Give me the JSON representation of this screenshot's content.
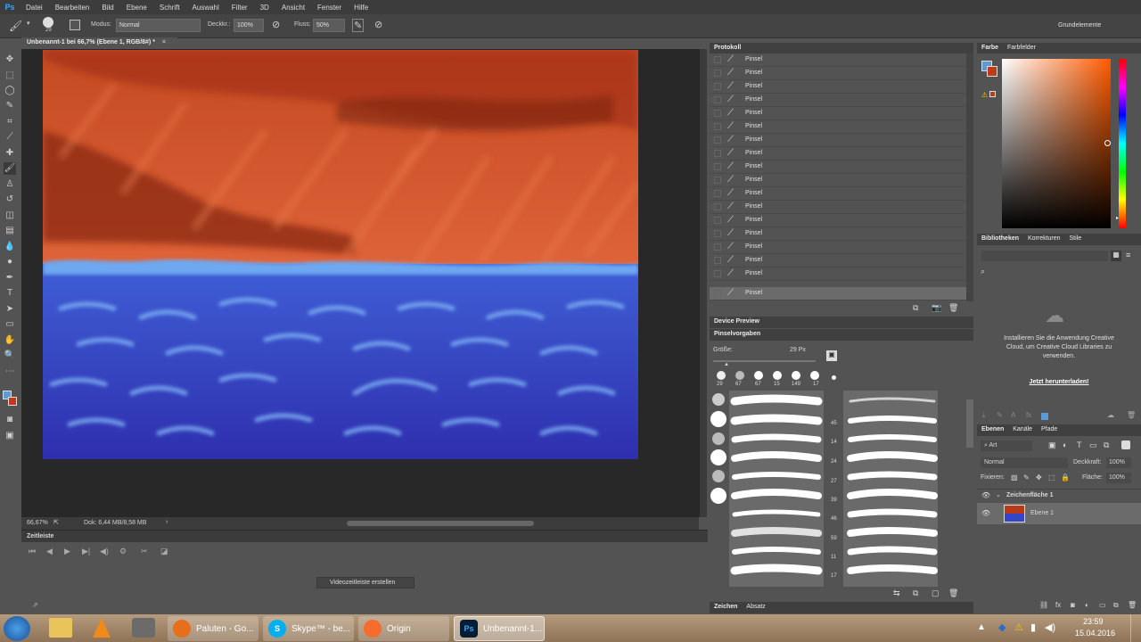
{
  "menubar": {
    "logo": "Ps",
    "items": [
      "Datei",
      "Bearbeiten",
      "Bild",
      "Ebene",
      "Schrift",
      "Auswahl",
      "Filter",
      "3D",
      "Ansicht",
      "Fenster",
      "Hilfe"
    ]
  },
  "options": {
    "brush_size": "29",
    "modus_label": "Modus:",
    "modus_value": "Normal",
    "deckkr_label": "Deckkr.:",
    "deckkr_value": "100%",
    "fluss_label": "Fluss:",
    "fluss_value": "50%",
    "workspace": "Grundelemente"
  },
  "document": {
    "tab_title": "Unbenannt-1 bei 66,7% (Ebene 1, RGB/8#) *",
    "zoom": "66,67%",
    "doc_info": "Dok: 6,44 MB/8,58 MB"
  },
  "timeline": {
    "title": "Zeitleiste",
    "create_button": "Videozeitleiste erstellen"
  },
  "history": {
    "title": "Protokoll",
    "items": [
      "Pinsel",
      "Pinsel",
      "Pinsel",
      "Pinsel",
      "Pinsel",
      "Pinsel",
      "Pinsel",
      "Pinsel",
      "Pinsel",
      "Pinsel",
      "Pinsel",
      "Pinsel",
      "Pinsel",
      "Pinsel",
      "Pinsel",
      "Pinsel",
      "Pinsel",
      "Pinsel"
    ]
  },
  "device_preview": {
    "title": "Device Preview"
  },
  "brush_presets": {
    "title": "Pinselvorgaben",
    "size_label": "Größe:",
    "size_value": "29 Px",
    "preset_sizes": [
      "29",
      "67",
      "67",
      "15",
      "149",
      "17"
    ],
    "side_numbers": [
      "45",
      "14",
      "24",
      "27",
      "39",
      "46",
      "59",
      "11",
      "17"
    ]
  },
  "color_panel": {
    "tabs": [
      "Farbe",
      "Farbfelder"
    ]
  },
  "libraries": {
    "tabs": [
      "Bibliotheken",
      "Korrekturen",
      "Stile"
    ],
    "message": "Installieren Sie die Anwendung Creative Cloud, um Creative Cloud Libraries zu verwenden.",
    "download_link": "Jetzt herunterladen!"
  },
  "layers": {
    "tabs": [
      "Ebenen",
      "Kanäle",
      "Pfade"
    ],
    "filter_kind": "Art",
    "blend_mode": "Normal",
    "opacity_label": "Deckkraft:",
    "opacity_value": "100%",
    "lock_label": "Fixieren:",
    "fill_label": "Fläche:",
    "fill_value": "100%",
    "artboard": "Zeichenfläche 1",
    "layer_name": "Ebene 1"
  },
  "bottom_tabs": [
    "Zeichen",
    "Absatz"
  ],
  "taskbar": {
    "windows": [
      "Paluten - Go...",
      "Skype™ - be...",
      "Origin",
      "Unbenannt-1..."
    ],
    "time": "23:59",
    "date": "15.04.2016"
  },
  "colors": {
    "foreground": "#5b9bd5",
    "background": "#c0391b",
    "sky": "#d85a30",
    "sea": "#3346c8"
  }
}
